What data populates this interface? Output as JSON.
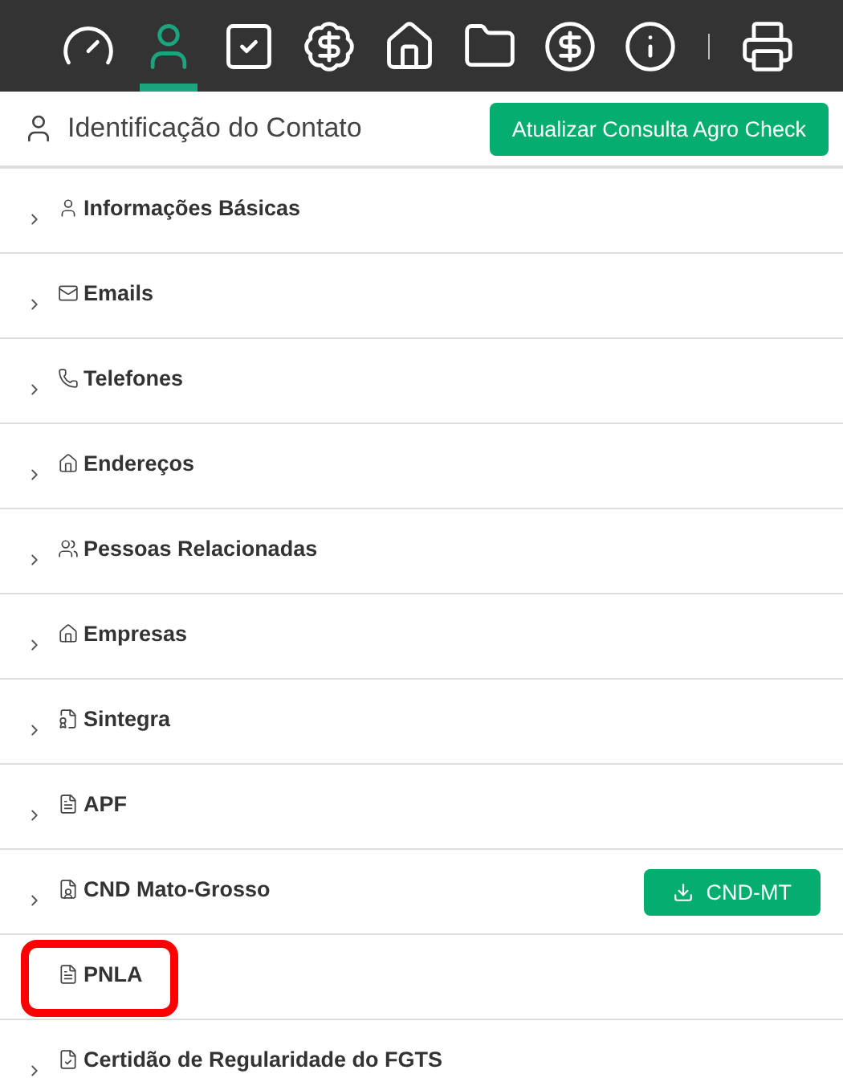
{
  "toolbar": {
    "items": [
      {
        "selected": false
      },
      {
        "selected": true
      },
      {
        "selected": false
      },
      {
        "selected": false
      },
      {
        "selected": false
      },
      {
        "selected": false
      },
      {
        "selected": false
      },
      {
        "selected": false
      },
      {
        "selected": false
      }
    ]
  },
  "header": {
    "title": "Identificação do Contato",
    "button": "Atualizar Consulta Agro Check"
  },
  "sections": [
    {
      "label": "Informações Básicas",
      "highlighted": false
    },
    {
      "label": "Emails",
      "highlighted": false
    },
    {
      "label": "Telefones",
      "highlighted": false
    },
    {
      "label": "Endereços",
      "highlighted": false
    },
    {
      "label": "Pessoas Relacionadas",
      "highlighted": false
    },
    {
      "label": "Empresas",
      "highlighted": false
    },
    {
      "label": "Sintegra",
      "highlighted": false
    },
    {
      "label": "APF",
      "highlighted": false
    },
    {
      "label": "CND Mato-Grosso",
      "highlighted": false,
      "button": "CND-MT"
    },
    {
      "label": "PNLA",
      "highlighted": true
    },
    {
      "label": "Certidão de Regularidade do FGTS",
      "highlighted": false
    }
  ]
}
